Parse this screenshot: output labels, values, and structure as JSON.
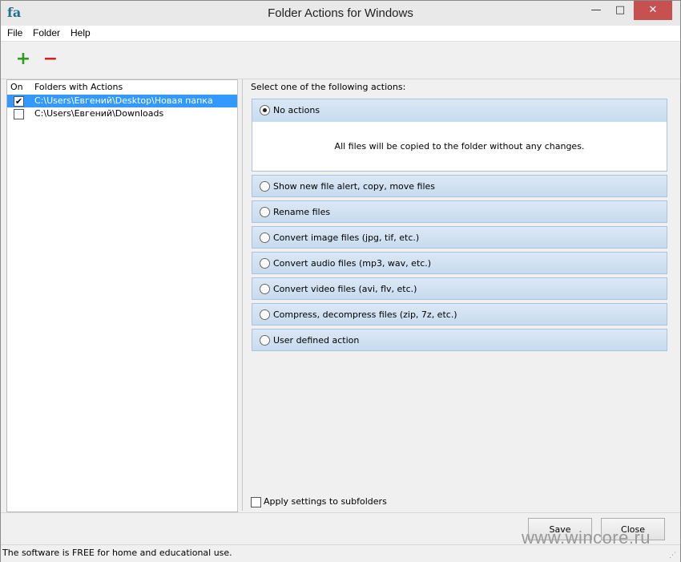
{
  "window": {
    "app_icon_text": "fa",
    "title": "Folder Actions for Windows",
    "minimize": "—",
    "maximize": "□",
    "close": "✕"
  },
  "menu": [
    "File",
    "Folder",
    "Help"
  ],
  "toolbar": {
    "add": "+",
    "remove": "−"
  },
  "folders": {
    "col_on": "On",
    "col_folders": "Folders with Actions",
    "rows": [
      {
        "checked": true,
        "path": "C:\\Users\\Евгений\\Desktop\\Новая папка",
        "selected": true
      },
      {
        "checked": false,
        "path": "C:\\Users\\Евгений\\Downloads",
        "selected": false
      }
    ]
  },
  "actions": {
    "prompt": "Select one of the following actions:",
    "items": [
      {
        "label": "No actions",
        "selected": true
      },
      {
        "label": "Show new file alert, copy, move files",
        "selected": false
      },
      {
        "label": "Rename files",
        "selected": false
      },
      {
        "label": "Convert image files (jpg, tif, etc.)",
        "selected": false
      },
      {
        "label": "Convert audio files (mp3, wav, etc.)",
        "selected": false
      },
      {
        "label": "Convert video files (avi, flv, etc.)",
        "selected": false
      },
      {
        "label": "Compress, decompress files (zip, 7z, etc.)",
        "selected": false
      },
      {
        "label": "User defined action",
        "selected": false
      }
    ],
    "description": "All files will be copied to the folder without any changes.",
    "apply_subfolders": "Apply settings to subfolders"
  },
  "buttons": {
    "save": "Save",
    "close": "Close"
  },
  "watermark": "www.wincore.ru",
  "status": "The software is FREE for home and educational use."
}
